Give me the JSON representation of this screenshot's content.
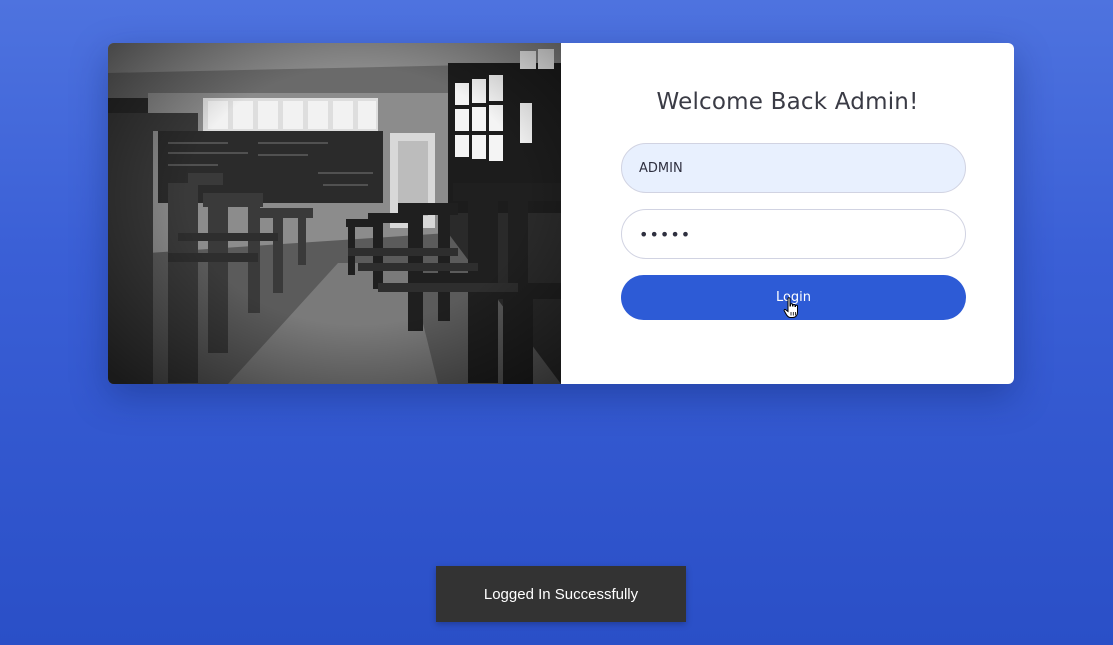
{
  "login": {
    "heading": "Welcome Back Admin!",
    "username_value": "ADMIN",
    "password_value": "•••••",
    "login_label": "Login"
  },
  "toast": {
    "message": "Logged In Successfully"
  },
  "colors": {
    "background_top": "#4e73df",
    "background_bottom": "#2a4fc7",
    "primary_button": "#2d5bd6",
    "autofill_background": "#e8f0fe",
    "toast_background": "#333333"
  },
  "icons": {
    "cursor": "hand-pointer-icon"
  }
}
